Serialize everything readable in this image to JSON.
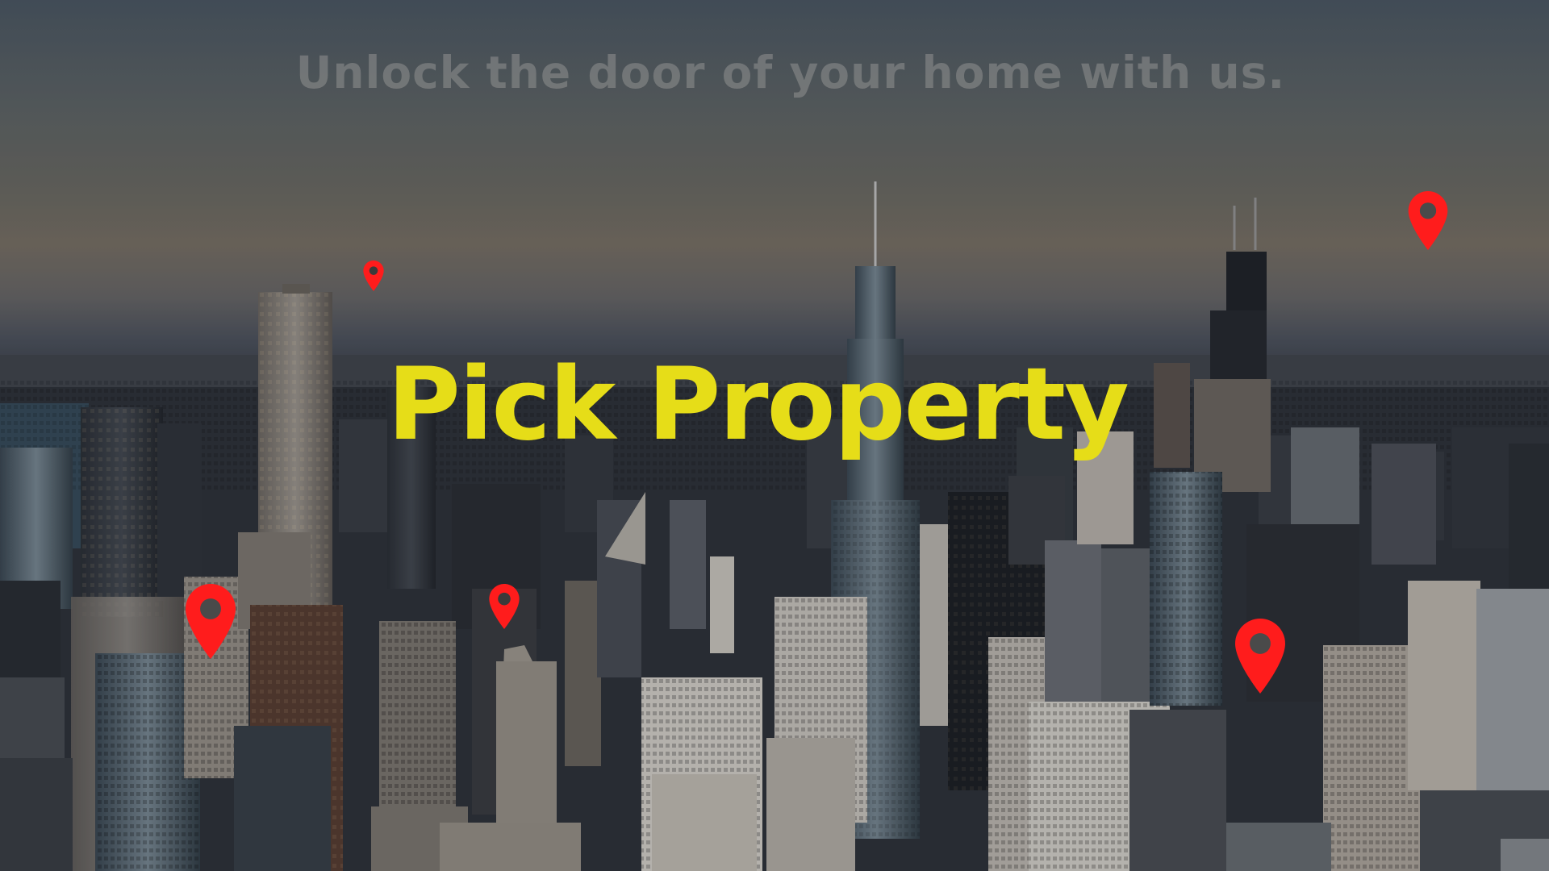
{
  "hero": {
    "tagline": "Unlock the door of your home with us.",
    "brand": "Pick Property"
  },
  "theme": {
    "brand_color": "#e6dd18",
    "tagline_color": "#919191",
    "pin_color": "#ff1c1c"
  },
  "icons": {
    "pin": "map-pin-icon"
  }
}
